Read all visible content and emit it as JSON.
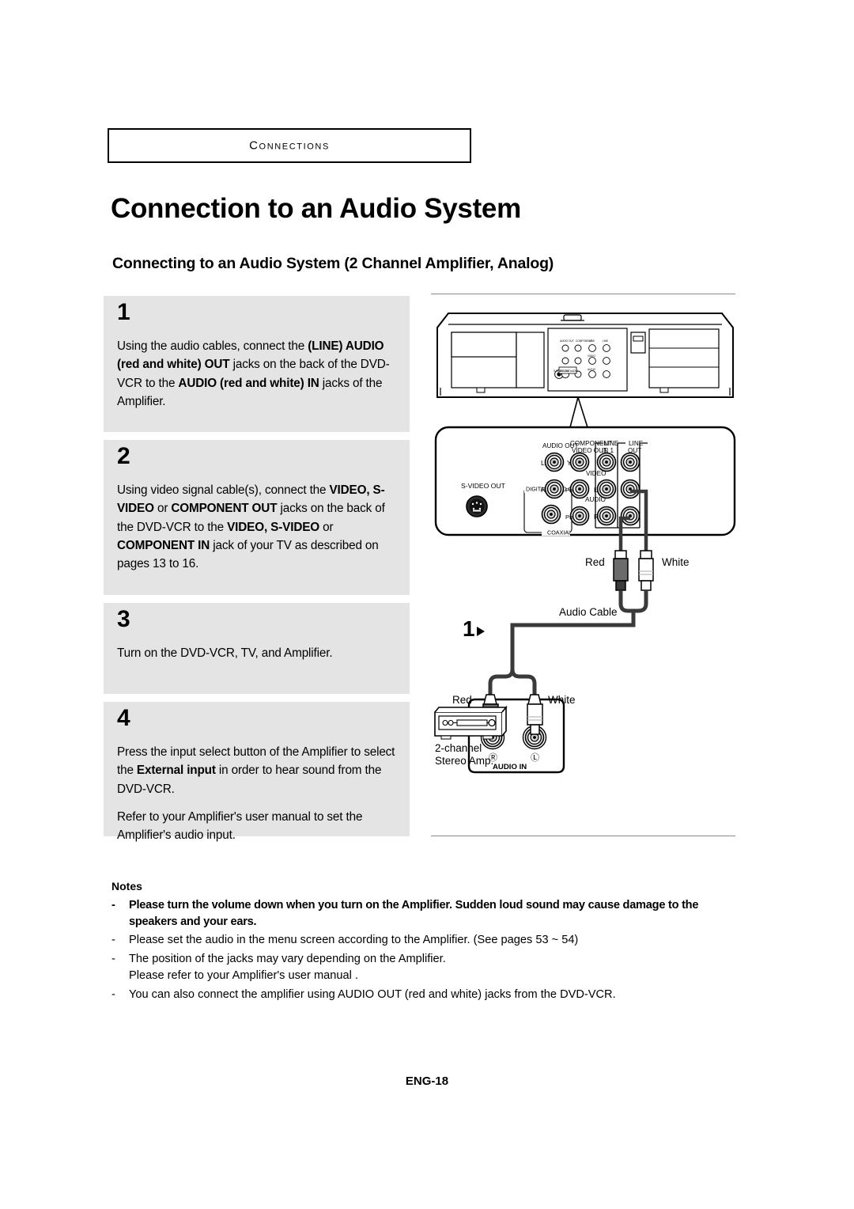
{
  "chapter": {
    "label": "Connections"
  },
  "title": "Connection to an Audio System",
  "subtitle": "Connecting to an Audio System (2 Channel Amplifier, Analog)",
  "steps": [
    {
      "number": "1",
      "paragraphs": [
        "Using the audio cables, connect the <b>(LINE) AUDIO (red and white) OUT</b> jacks on the back of the DVD-VCR to the <b>AUDIO (red and white) IN</b> jacks of the Amplifier."
      ]
    },
    {
      "number": "2",
      "paragraphs": [
        "Using video signal cable(s), connect the <b>VIDEO, S-VIDEO</b> or <b>COMPONENT OUT</b> jacks on the back of the DVD-VCR to the <b>VIDEO, S-VIDEO</b> or <b>COMPONENT IN</b> jack of your TV as described on pages 13 to 16."
      ]
    },
    {
      "number": "3",
      "paragraphs": [
        "Turn on the DVD-VCR, TV, and Amplifier."
      ]
    },
    {
      "number": "4",
      "paragraphs": [
        "Press the input select button of the Amplifier to select the <b>External input</b> in order to hear sound from the DVD-VCR.",
        "Refer to your Amplifier's user manual to set the Amplifier's audio input."
      ]
    }
  ],
  "notes": {
    "title": "Notes",
    "items": [
      {
        "dash": "-",
        "bold": true,
        "text": "Please turn the volume down when you turn on the Amplifier. Sudden loud sound may cause damage to the speakers and your ears."
      },
      {
        "dash": "-",
        "bold": false,
        "text": "Please set the audio in the menu screen according to the Amplifier. (See pages 53 ~ 54)"
      },
      {
        "dash": "-",
        "bold": false,
        "text": "The position of the jacks may vary depending on the Amplifier.<br>Please refer to your Amplifier's user manual ."
      },
      {
        "dash": "-",
        "bold": false,
        "text": "You can also connect the amplifier using AUDIO OUT (red and white) jacks from the DVD-VCR."
      }
    ]
  },
  "footer": {
    "page": "ENG-18"
  },
  "diagram": {
    "panel_labels": {
      "audio_out": "AUDIO OUT",
      "component_video_out_1": "COMPONENT",
      "component_video_out_2": "VIDEO OUT",
      "line_in_1": "LINE",
      "line_in_2": "IN 1",
      "line_out_1": "LINE",
      "line_out_2": "OUT",
      "s_video_out": "S-VIDEO OUT",
      "digital_audio_out": "DIGITAL AUDIO OUT",
      "coaxial": "COAXIAL",
      "video": "VIDEO",
      "audio": "AUDIO",
      "jack_l_top": "L",
      "jack_r_mid": "R",
      "jack_y": "Y",
      "jack_pb": "Pʙ",
      "jack_pr": "Pʀ",
      "jack_l_mid": "L",
      "jack_r_bot": "R"
    },
    "cable_labels": {
      "red_top": "Red",
      "white_top": "White",
      "audio_cable": "Audio Cable",
      "step_marker": "1",
      "red_amp": "Red",
      "white_amp": "White",
      "audio_in": "AUDIO IN",
      "amp_r": "Ⓡ",
      "amp_l": "Ⓛ",
      "amp_name_1": "2-channel",
      "amp_name_2": "Stereo Amp."
    }
  }
}
